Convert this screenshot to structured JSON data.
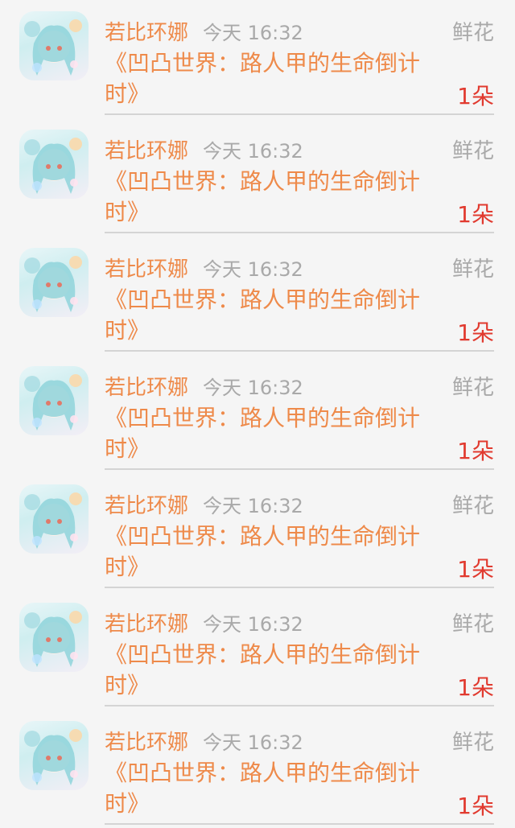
{
  "records": [
    {
      "name": "若比环娜",
      "time": "今天 16:32",
      "gift_type": "鲜花",
      "title": "《凹凸世界：路人甲的生命倒计时》",
      "count": "1朵"
    },
    {
      "name": "若比环娜",
      "time": "今天 16:32",
      "gift_type": "鲜花",
      "title": "《凹凸世界：路人甲的生命倒计时》",
      "count": "1朵"
    },
    {
      "name": "若比环娜",
      "time": "今天 16:32",
      "gift_type": "鲜花",
      "title": "《凹凸世界：路人甲的生命倒计时》",
      "count": "1朵"
    },
    {
      "name": "若比环娜",
      "time": "今天 16:32",
      "gift_type": "鲜花",
      "title": "《凹凸世界：路人甲的生命倒计时》",
      "count": "1朵"
    },
    {
      "name": "若比环娜",
      "time": "今天 16:32",
      "gift_type": "鲜花",
      "title": "《凹凸世界：路人甲的生命倒计时》",
      "count": "1朵"
    },
    {
      "name": "若比环娜",
      "time": "今天 16:32",
      "gift_type": "鲜花",
      "title": "《凹凸世界：路人甲的生命倒计时》",
      "count": "1朵"
    },
    {
      "name": "若比环娜",
      "time": "今天 16:32",
      "gift_type": "鲜花",
      "title": "《凹凸世界：路人甲的生命倒计时》",
      "count": "1朵"
    }
  ]
}
